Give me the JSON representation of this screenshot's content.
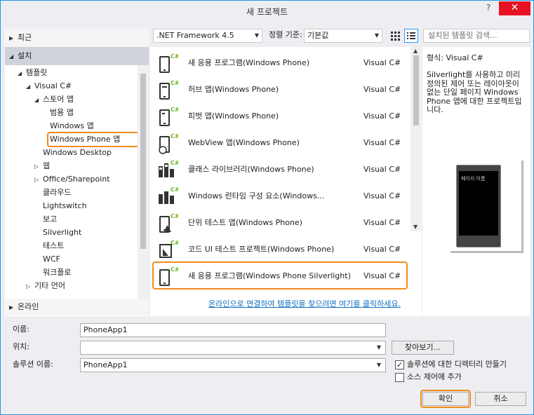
{
  "window": {
    "title": "새 프로젝트",
    "help": "?",
    "close": "✕"
  },
  "left": {
    "recent": "최근",
    "installed": "설치",
    "templates": "템플릿",
    "visual_csharp": "Visual C#",
    "store_apps": "스토어 앱",
    "universal_apps": "범용 앱",
    "windows_apps": "Windows 앱",
    "windows_phone_apps": "Windows Phone 앱",
    "windows_desktop": "Windows Desktop",
    "web": "웹",
    "office_sharepoint": "Office/Sharepoint",
    "cloud": "클라우드",
    "lightswitch": "Lightswitch",
    "reporting": "보고",
    "silverlight": "Silverlight",
    "test": "테스트",
    "wcf": "WCF",
    "workflow": "워크플로",
    "other_languages": "기타 언어",
    "online": "온라인"
  },
  "toolbar": {
    "framework": ".NET Framework 4.5",
    "sort_label": "정렬 기준:",
    "sort_value": "기본값",
    "search_placeholder": "설치된 템플릿 검색..."
  },
  "templates": [
    {
      "name": "새 응용 프로그램(Windows Phone)",
      "lang": "Visual C#"
    },
    {
      "name": "허브 앱(Windows Phone)",
      "lang": "Visual C#"
    },
    {
      "name": "피벗 앱(Windows Phone)",
      "lang": "Visual C#"
    },
    {
      "name": "WebView 앱(Windows Phone)",
      "lang": "Visual C#"
    },
    {
      "name": "클래스 라이브러리(Windows Phone)",
      "lang": "Visual C#"
    },
    {
      "name": "Windows 런타임 구성 요소(Windows...",
      "lang": "Visual C#"
    },
    {
      "name": "단위 테스트 앱(Windows Phone)",
      "lang": "Visual C#"
    },
    {
      "name": "코드 UI 테스트 프로젝트(Windows Phone)",
      "lang": "Visual C#"
    },
    {
      "name": "새 응용 프로그램(Windows Phone Silverlight)",
      "lang": "Visual C#"
    }
  ],
  "online_link": "온라인으로 연결하여 템플릿을 찾으려면 여기를 클릭하세요.",
  "details": {
    "type": "형식: Visual C#",
    "description": "Silverlight를 사용하고 미리 정의된 제어 또는 레이아웃이 없는 단일 페이지 Windows Phone 앱에 대한 프로젝트입니다.",
    "phone_title": "페이지 이름"
  },
  "form": {
    "name_label": "이름:",
    "name_value": "PhoneApp1",
    "location_label": "위치:",
    "location_value": "",
    "browse": "찾아보기...",
    "solution_label": "솔루션 이름:",
    "solution_value": "PhoneApp1",
    "create_dir": "솔루션에 대한 디렉터리 만들기",
    "create_dir_checked": true,
    "source_control": "소스 제어에 추가",
    "source_control_checked": false,
    "ok": "확인",
    "cancel": "취소"
  },
  "colors": {
    "accent": "#1c97ea",
    "highlight": "#f08c1a",
    "csharp_green": "#68b723",
    "link": "#0e70c0"
  }
}
